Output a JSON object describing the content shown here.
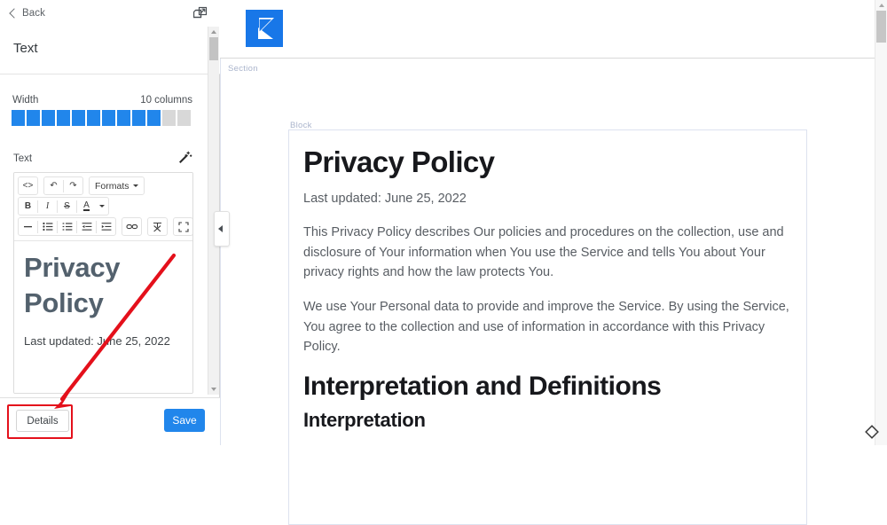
{
  "sidebar": {
    "back_label": "Back",
    "open_new_icon": "open-in-new-icon",
    "panel_title": "Text",
    "width": {
      "label": "Width",
      "value_text": "10 columns",
      "filled": 10,
      "total": 12,
      "active_color": "#2186eb",
      "inactive_color": "#d8d8d8"
    },
    "text_field": {
      "label": "Text",
      "wand_icon": "magic-wand-icon",
      "toolbar": {
        "row1": [
          {
            "icon": "source-code-icon",
            "glyph": "<>"
          },
          {
            "icon": "undo-icon",
            "glyph": "↶"
          },
          {
            "icon": "redo-icon",
            "glyph": "↷"
          },
          {
            "icon": "formats-dropdown",
            "glyph": "Formats"
          }
        ],
        "row2": [
          {
            "icon": "bold-icon",
            "glyph": "B"
          },
          {
            "icon": "italic-icon",
            "glyph": "I"
          },
          {
            "icon": "strikethrough-icon",
            "glyph": "S"
          },
          {
            "icon": "text-color-icon",
            "glyph": "A"
          }
        ],
        "row3": [
          {
            "icon": "horizontal-rule-icon",
            "glyph": "—"
          },
          {
            "icon": "bullet-list-icon",
            "glyph": "☰"
          },
          {
            "icon": "numbered-list-icon",
            "glyph": "☰"
          },
          {
            "icon": "outdent-icon",
            "glyph": "⇤"
          },
          {
            "icon": "indent-icon",
            "glyph": "⇥"
          },
          {
            "icon": "link-icon",
            "glyph": "∞"
          },
          {
            "icon": "clear-formatting-icon",
            "glyph": "✗"
          },
          {
            "icon": "fullscreen-icon",
            "glyph": "⛶"
          }
        ]
      },
      "content_heading": "Privacy Policy",
      "content_paragraph": "Last updated: June 25, 2022"
    },
    "footer": {
      "details_label": "Details",
      "save_label": "Save",
      "save_color": "#2186eb"
    },
    "scrollbar": {
      "up_icon": "scroll-up-arrow-icon",
      "down_icon": "scroll-down-arrow-icon"
    }
  },
  "main": {
    "logo_icon": "kentico-k-logo-icon",
    "logo_color": "#1877e8",
    "section_label": "Section",
    "block_label": "Block",
    "collapse_icon": "collapse-panel-icon",
    "diamond_icon": "diamond-outline-icon",
    "document": {
      "heading": "Privacy Policy",
      "updated": "Last updated: June 25, 2022",
      "paragraphs": [
        "This Privacy Policy describes Our policies and procedures on the collection, use and disclosure of Your information when You use the Service and tells You about Your privacy rights and how the law protects You.",
        "We use Your Personal data to provide and improve the Service. By using the Service, You agree to the collection and use of information in accordance with this Privacy Policy."
      ],
      "heading2": "Interpretation and Definitions",
      "heading3": "Interpretation"
    }
  },
  "annotation": {
    "arrow_color": "#e4101b",
    "highlight_color": "#e4101b",
    "target": "details-button"
  }
}
